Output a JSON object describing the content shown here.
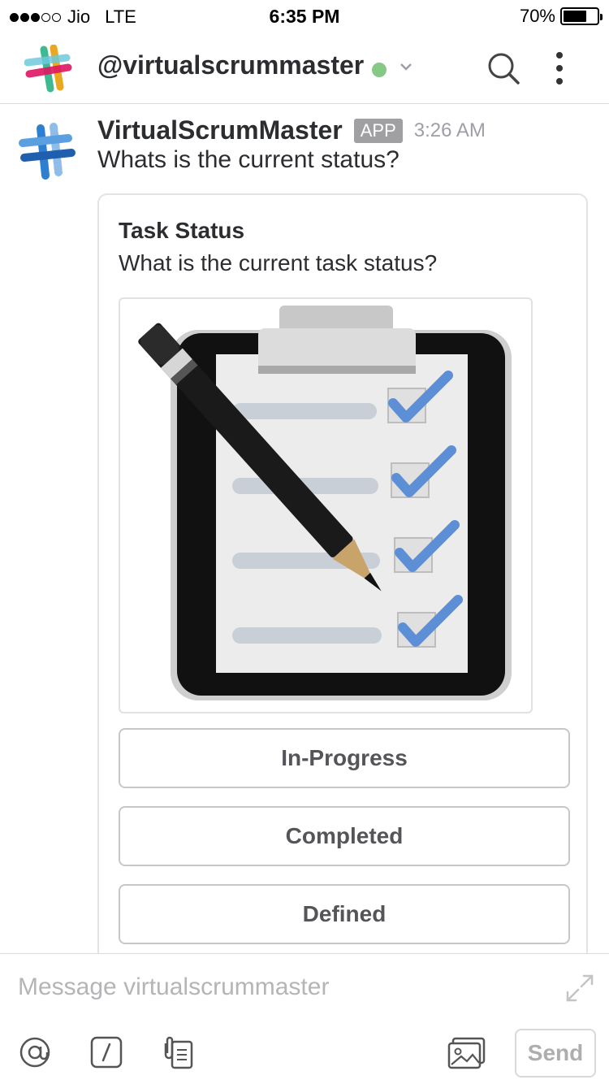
{
  "status_bar": {
    "carrier": "Jio",
    "network": "LTE",
    "time": "6:35 PM",
    "battery": "70%",
    "battery_level": 0.7,
    "signal_bars_filled": 3,
    "signal_bars_total": 5
  },
  "header": {
    "channel": "@virtualscrummaster",
    "presence_color": "#86c886",
    "icons": [
      "slack-logo-icon",
      "chevron-down-icon",
      "search-icon",
      "more-vertical-icon"
    ]
  },
  "message": {
    "sender": "VirtualScrumMaster",
    "badge": "APP",
    "time": "3:26 AM",
    "text": "Whats is the current status?",
    "attachment": {
      "title": "Task Status",
      "text": "What is the current task status?",
      "image_icon": "clipboard-checklist-icon",
      "actions": [
        {
          "label": "In-Progress"
        },
        {
          "label": "Completed"
        },
        {
          "label": "Defined"
        }
      ]
    }
  },
  "composer": {
    "placeholder": "Message virtualscrummaster",
    "send_label": "Send",
    "icons": [
      "at-icon",
      "slash-icon",
      "attachment-icon",
      "image-icon",
      "expand-icon"
    ]
  }
}
